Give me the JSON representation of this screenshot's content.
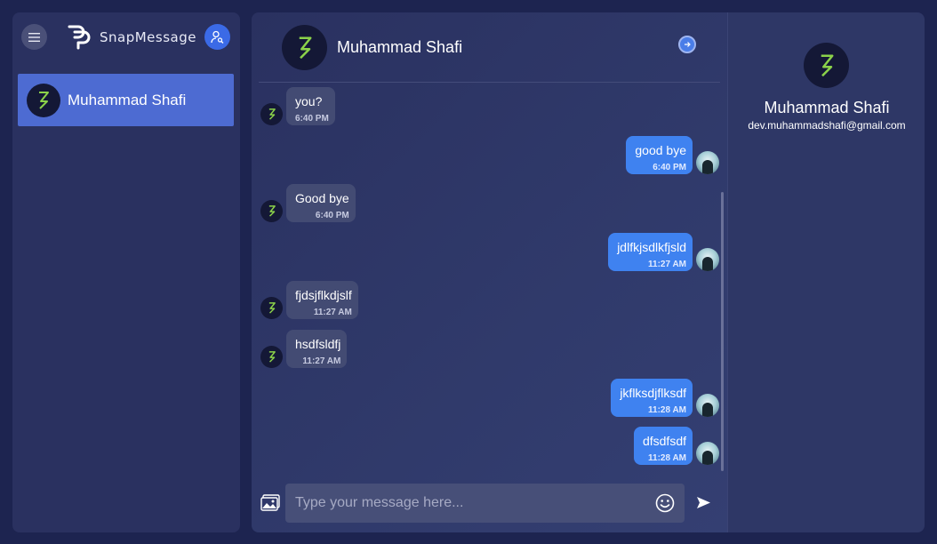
{
  "app": {
    "name": "SnapMessage"
  },
  "sidebar": {
    "contacts": [
      {
        "name": "Muhammad Shafi",
        "selected": true
      }
    ]
  },
  "chat": {
    "header": {
      "name": "Muhammad Shafi"
    },
    "messages": [
      {
        "direction": "in",
        "text": "you?",
        "time": "6:40 PM"
      },
      {
        "direction": "out",
        "text": "good bye",
        "time": "6:40 PM"
      },
      {
        "direction": "in",
        "text": "Good bye",
        "time": "6:40 PM"
      },
      {
        "direction": "out",
        "text": "jdlfkjsdlkfjsld",
        "time": "11:27 AM"
      },
      {
        "direction": "in",
        "text": "fjdsjflkdjslf",
        "time": "11:27 AM"
      },
      {
        "direction": "in",
        "text": "hsdfsldfj",
        "time": "11:27 AM"
      },
      {
        "direction": "out",
        "text": "jkflksdjflksdf",
        "time": "11:28 AM"
      },
      {
        "direction": "out",
        "text": "dfsdfsdf",
        "time": "11:28 AM"
      }
    ],
    "composer": {
      "placeholder": "Type your message here...",
      "value": ""
    }
  },
  "profile": {
    "name": "Muhammad Shafi",
    "email": "dev.muhammadshafi@gmail.com"
  },
  "icons": {
    "menu": "hamburger-icon",
    "search_user": "user-search-icon",
    "contact_avatar": "bolt-icon",
    "header_action": "arrow-right-circle-icon",
    "attach_image": "image-icon",
    "emoji": "smiley-icon",
    "send": "send-icon"
  },
  "colors": {
    "background": "#1d2450",
    "panel": "#2a3160",
    "selected_contact": "#4d6bd2",
    "outgoing_bubble": "#3f82f0",
    "incoming_bubble": "#434b73",
    "bolt_accent": "#8bd24a"
  }
}
